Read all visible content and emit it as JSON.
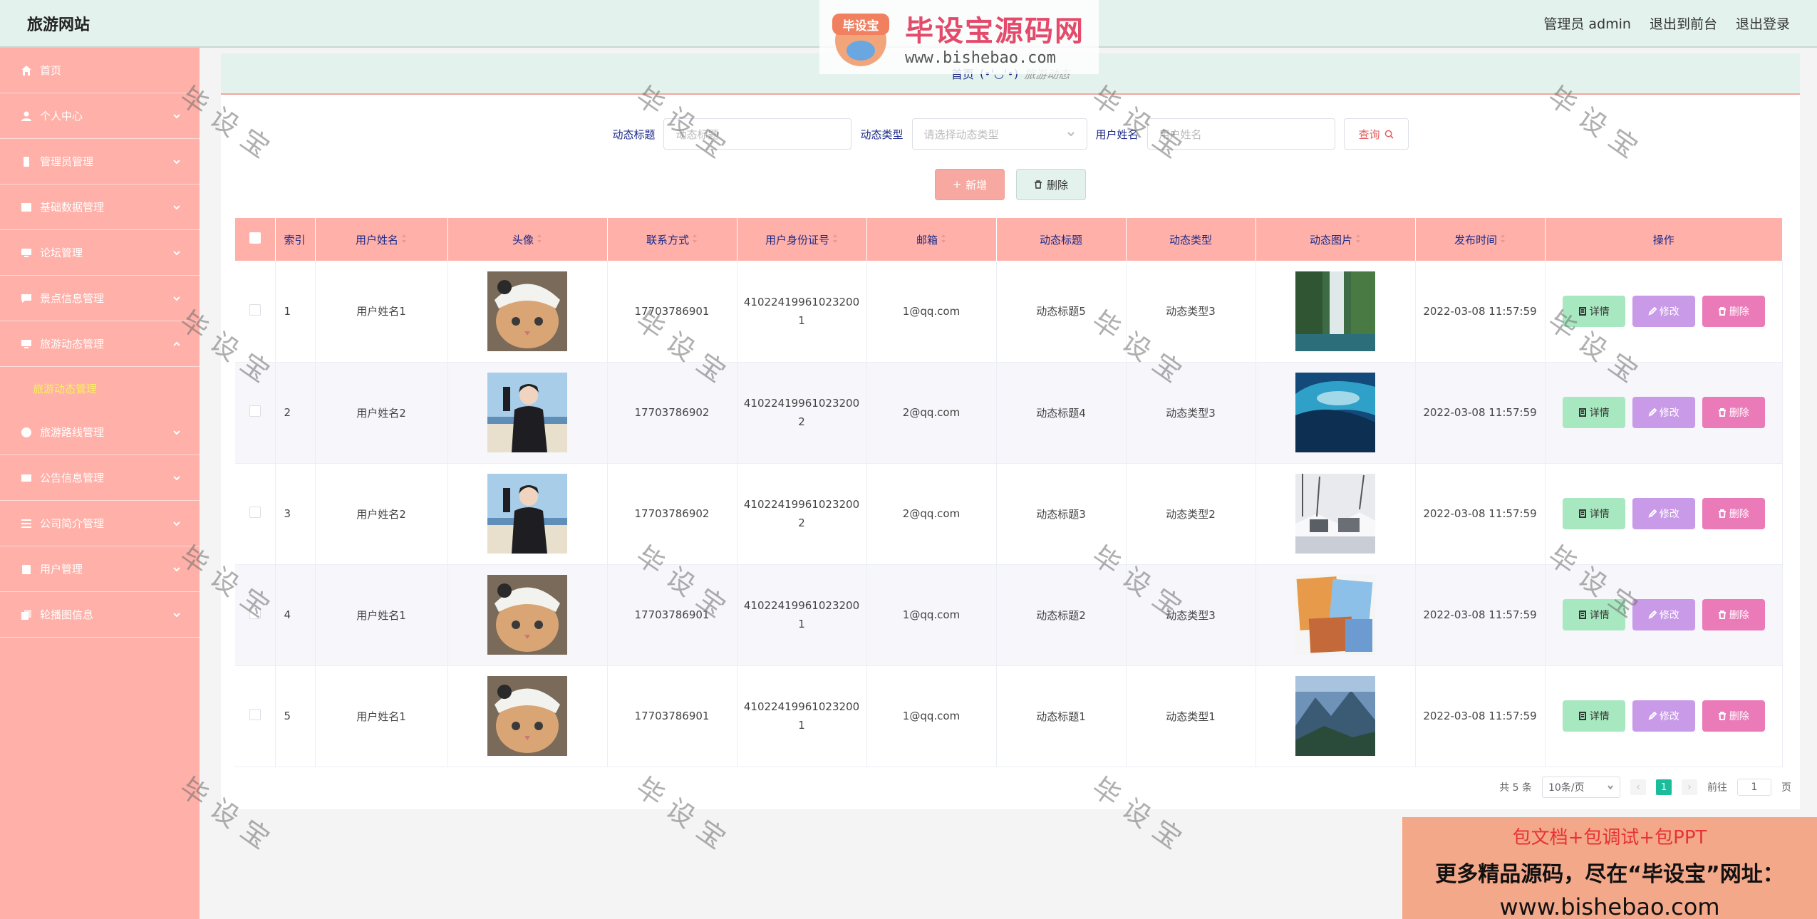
{
  "header": {
    "brand": "旅游网站",
    "user_label": "管理员 admin",
    "front_link": "退出到前台",
    "logout_link": "退出登录"
  },
  "sidebar": {
    "items": [
      {
        "label": "首页",
        "icon": "home-icon"
      },
      {
        "label": "个人中心",
        "icon": "user-icon"
      },
      {
        "label": "管理员管理",
        "icon": "admin-icon"
      },
      {
        "label": "基础数据管理",
        "icon": "data-icon"
      },
      {
        "label": "论坛管理",
        "icon": "monitor-icon"
      },
      {
        "label": "景点信息管理",
        "icon": "message-icon"
      },
      {
        "label": "旅游动态管理",
        "icon": "monitor-icon"
      },
      {
        "label": "旅游路线管理",
        "icon": "compass-icon"
      },
      {
        "label": "公告信息管理",
        "icon": "mail-icon"
      },
      {
        "label": "公司简介管理",
        "icon": "list-icon"
      },
      {
        "label": "用户管理",
        "icon": "clipboard-icon"
      },
      {
        "label": "轮播图信息",
        "icon": "copy-icon"
      }
    ],
    "active_submenu": "旅游动态管理"
  },
  "breadcrumb": {
    "home": "首页",
    "sep": "(•'◡'•)",
    "current": "旅游动态"
  },
  "search": {
    "title_label": "动态标题",
    "title_placeholder": "动态标题",
    "type_label": "动态类型",
    "type_placeholder": "请选择动态类型",
    "name_label": "用户姓名",
    "name_placeholder": "用户姓名",
    "query_label": "查询"
  },
  "actions": {
    "add_label": "新增",
    "delete_label": "删除"
  },
  "table": {
    "headers": [
      "索引",
      "用户姓名",
      "头像",
      "联系方式",
      "用户身份证号",
      "邮箱",
      "动态标题",
      "动态类型",
      "动态图片",
      "发布时间",
      "操作"
    ],
    "rows": [
      {
        "index": "1",
        "name": "用户姓名1",
        "avatar": "cat",
        "phone": "17703786901",
        "id_a": "41022419961023200",
        "id_b": "1",
        "email": "1@qq.com",
        "title": "动态标题5",
        "type": "动态类型3",
        "image": "waterfall",
        "time": "2022-03-08 11:57:59"
      },
      {
        "index": "2",
        "name": "用户姓名2",
        "avatar": "person",
        "phone": "17703786902",
        "id_a": "41022419961023200",
        "id_b": "2",
        "email": "2@qq.com",
        "title": "动态标题4",
        "type": "动态类型3",
        "image": "wave",
        "time": "2022-03-08 11:57:59"
      },
      {
        "index": "3",
        "name": "用户姓名2",
        "avatar": "person",
        "phone": "17703786902",
        "id_a": "41022419961023200",
        "id_b": "2",
        "email": "2@qq.com",
        "title": "动态标题3",
        "type": "动态类型2",
        "image": "snow",
        "time": "2022-03-08 11:57:59"
      },
      {
        "index": "4",
        "name": "用户姓名1",
        "avatar": "cat",
        "phone": "17703786901",
        "id_a": "41022419961023200",
        "id_b": "1",
        "email": "1@qq.com",
        "title": "动态标题2",
        "type": "动态类型3",
        "image": "collage",
        "time": "2022-03-08 11:57:59"
      },
      {
        "index": "5",
        "name": "用户姓名1",
        "avatar": "cat",
        "phone": "17703786901",
        "id_a": "41022419961023200",
        "id_b": "1",
        "email": "1@qq.com",
        "title": "动态标题1",
        "type": "动态类型1",
        "image": "mountain",
        "time": "2022-03-08 11:57:59"
      }
    ],
    "op_detail": "详情",
    "op_edit": "修改",
    "op_delete": "删除"
  },
  "pager": {
    "total": "共 5 条",
    "size": "10条/页",
    "current_page": "1",
    "goto_label": "前往",
    "goto_value": "1",
    "page_suffix": "页"
  },
  "watermark": {
    "logo_badge": "毕设宝",
    "logo_title": "毕设宝源码网",
    "logo_url": "www.bishebao.com",
    "stamp": "毕设宝",
    "promo_line1": "包文档+包调试+包PPT",
    "promo_line2": "更多精品源码，尽在“毕设宝”网址：",
    "promo_line3": "www.bishebao.com"
  },
  "colors": {
    "sidebar": "#ffb0a8",
    "header": "#e3f2ec",
    "accent_text": "#1c2a8a",
    "detail_btn": "#a8e8c0",
    "edit_btn": "#c99ae8",
    "delete_btn": "#ea7ab8"
  }
}
